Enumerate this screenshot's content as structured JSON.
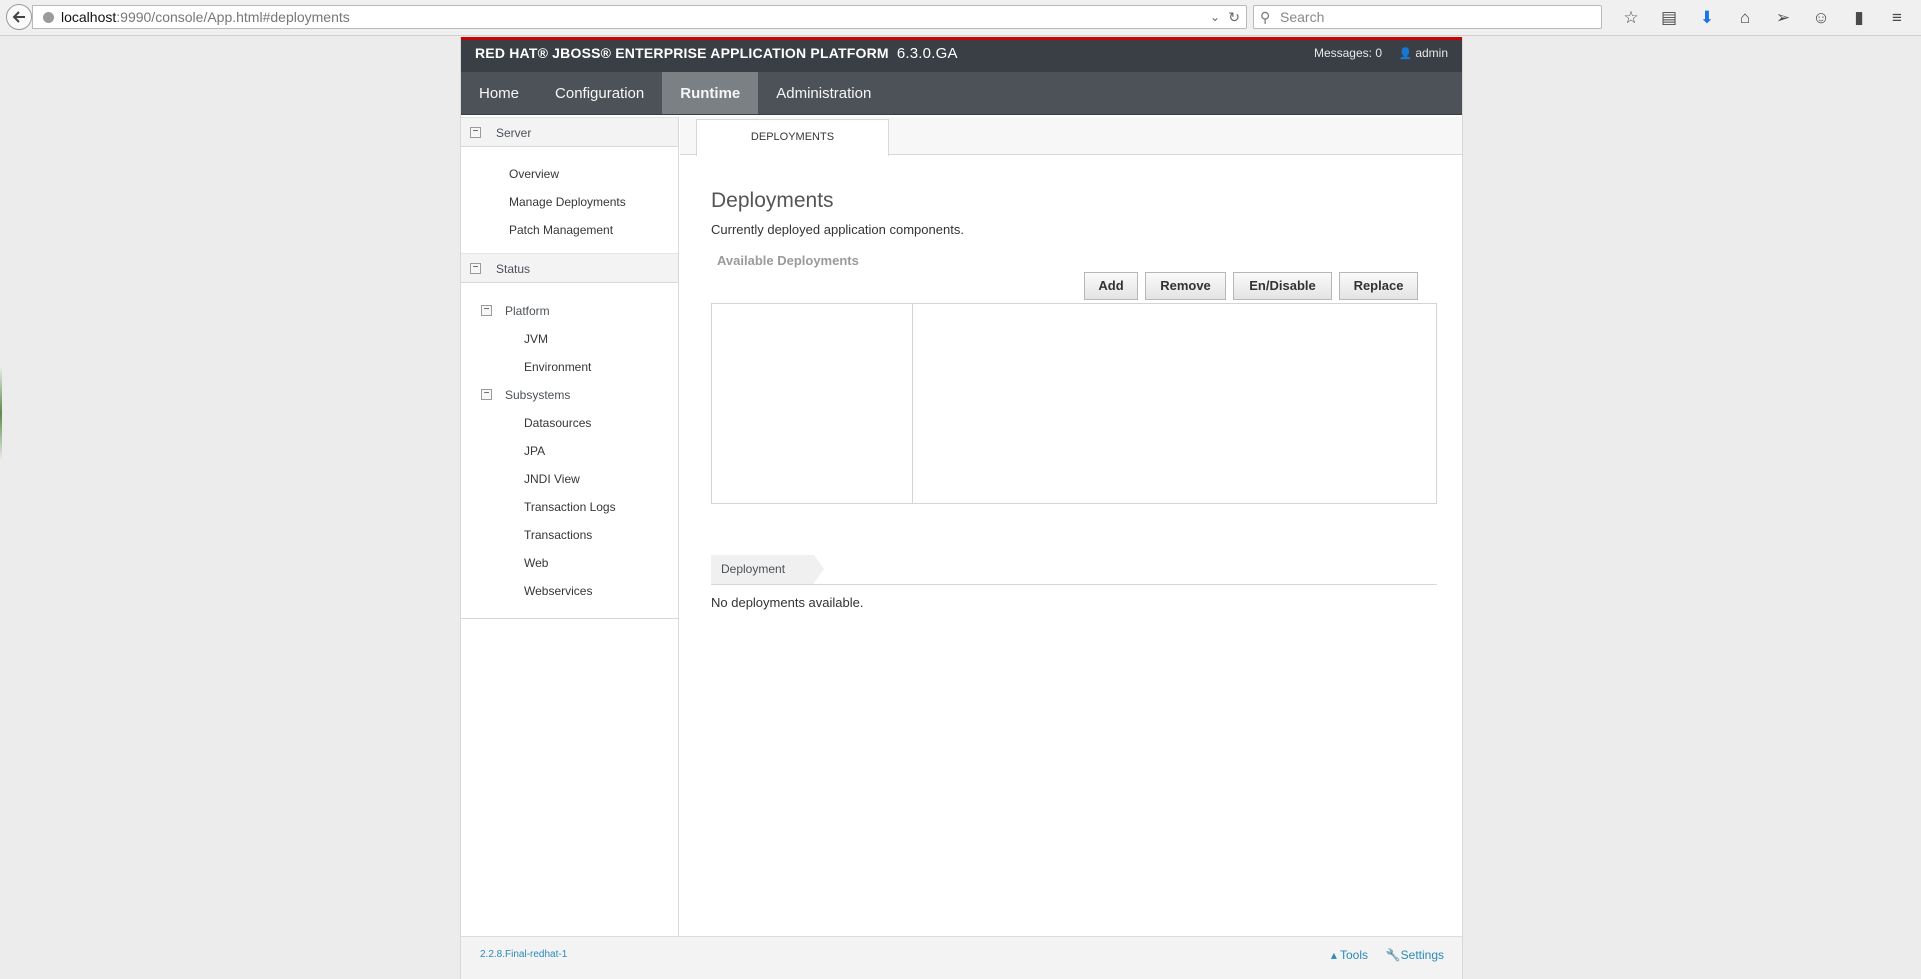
{
  "browser": {
    "url_host": "localhost",
    "url_rest": ":9990/console/App.html#deployments",
    "search_placeholder": "Search"
  },
  "brand": {
    "title": "RED HAT® JBOSS® ENTERPRISE APPLICATION PLATFORM",
    "version": "6.3.0.GA",
    "messages": "Messages: 0",
    "user": "admin"
  },
  "nav": {
    "items": [
      "Home",
      "Configuration",
      "Runtime",
      "Administration"
    ],
    "active": "Runtime"
  },
  "sidebar": {
    "server_label": "Server",
    "server_items": [
      "Overview",
      "Manage Deployments",
      "Patch Management"
    ],
    "status_label": "Status",
    "platform_label": "Platform",
    "platform_items": [
      "JVM",
      "Environment"
    ],
    "subsystems_label": "Subsystems",
    "subsystem_items": [
      "Datasources",
      "JPA",
      "JNDI View",
      "Transaction Logs",
      "Transactions",
      "Web",
      "Webservices"
    ]
  },
  "content": {
    "tab": "DEPLOYMENTS",
    "title": "Deployments",
    "description": "Currently deployed application components.",
    "subheading": "Available Deployments",
    "buttons": {
      "add": "Add",
      "remove": "Remove",
      "toggle": "En/Disable",
      "replace": "Replace"
    },
    "detail_tab": "Deployment",
    "empty_message": "No deployments available."
  },
  "footer": {
    "version": "2.2.8.Final-redhat-1",
    "tools": "Tools",
    "settings": "Settings"
  },
  "colors": {
    "brand_red": "#cc0000",
    "header_dark": "#393f44",
    "nav_bg": "#4d5258",
    "nav_active": "#7b8085",
    "link_blue": "#2a8ab8"
  }
}
